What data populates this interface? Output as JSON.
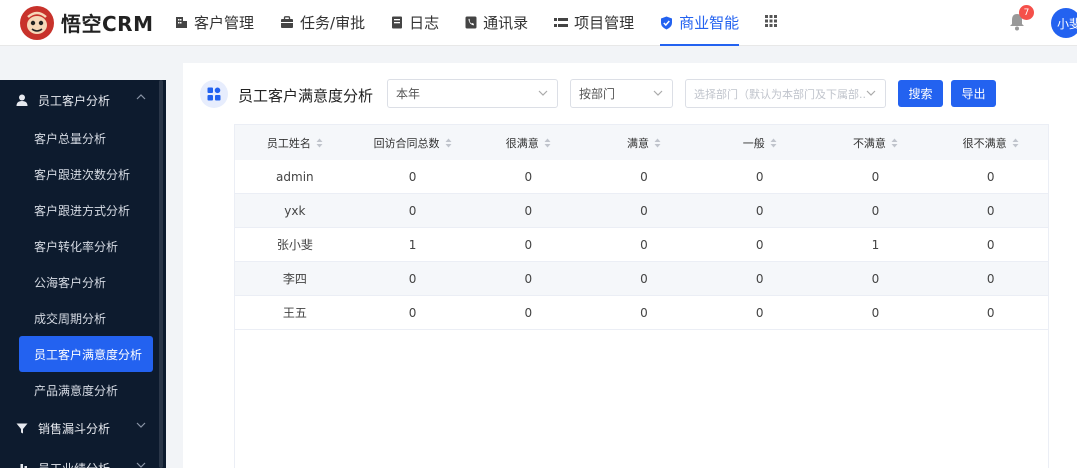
{
  "brand": {
    "name": "悟空CRM"
  },
  "nav": {
    "items": [
      {
        "label": "客户管理",
        "icon": "building-icon"
      },
      {
        "label": "任务/审批",
        "icon": "briefcase-icon"
      },
      {
        "label": "日志",
        "icon": "notebook-icon"
      },
      {
        "label": "通讯录",
        "icon": "contacts-icon"
      },
      {
        "label": "项目管理",
        "icon": "list-icon"
      },
      {
        "label": "商业智能",
        "icon": "shield-icon",
        "active": true
      }
    ],
    "notification_count": "7",
    "user_avatar": "小斐"
  },
  "sidebar": {
    "group_main": "员工客户分析",
    "items": [
      "客户总量分析",
      "客户跟进次数分析",
      "客户跟进方式分析",
      "客户转化率分析",
      "公海客户分析",
      "成交周期分析",
      "员工客户满意度分析",
      "产品满意度分析"
    ],
    "active_item": "员工客户满意度分析",
    "group_funnel": "销售漏斗分析",
    "group_performance": "员工业绩分析"
  },
  "page": {
    "title": "员工客户满意度分析",
    "filters": {
      "period": "本年",
      "scope": "按部门",
      "department_placeholder": "选择部门（默认为本部门及下属部..."
    },
    "buttons": {
      "search": "搜索",
      "export": "导出"
    }
  },
  "table": {
    "headers": [
      "员工姓名",
      "回访合同总数",
      "很满意",
      "满意",
      "一般",
      "不满意",
      "很不满意"
    ],
    "rows": [
      [
        "admin",
        "0",
        "0",
        "0",
        "0",
        "0",
        "0"
      ],
      [
        "yxk",
        "0",
        "0",
        "0",
        "0",
        "0",
        "0"
      ],
      [
        "张小斐",
        "1",
        "0",
        "0",
        "0",
        "1",
        "0"
      ],
      [
        "李四",
        "0",
        "0",
        "0",
        "0",
        "0",
        "0"
      ],
      [
        "王五",
        "0",
        "0",
        "0",
        "0",
        "0",
        "0"
      ]
    ]
  },
  "colors": {
    "accent": "#2362f0",
    "sidebar_bg": "#0d1b2e",
    "badge": "#f5504a",
    "logo": "#c8322b"
  }
}
